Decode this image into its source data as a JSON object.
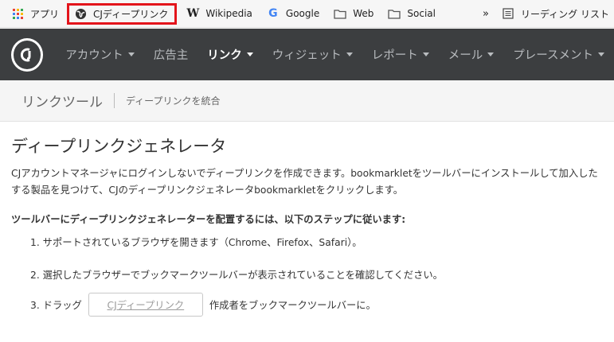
{
  "bookmarks": {
    "apps_label": "アプリ",
    "items": [
      {
        "label": "CJディープリンク",
        "icon": "globe-icon"
      },
      {
        "label": "Wikipedia",
        "icon": "wikipedia-icon"
      },
      {
        "label": "Google",
        "icon": "google-icon"
      },
      {
        "label": "Web",
        "icon": "folder-icon"
      },
      {
        "label": "Social",
        "icon": "folder-icon"
      }
    ],
    "overflow": "»",
    "reading_list": "リーディング リスト"
  },
  "nav": {
    "items": [
      {
        "label": "アカウント",
        "active": false
      },
      {
        "label": "広告主",
        "active": false
      },
      {
        "label": "リンク",
        "active": true
      },
      {
        "label": "ウィジェット",
        "active": false
      },
      {
        "label": "レポート",
        "active": false
      },
      {
        "label": "メール",
        "active": false
      },
      {
        "label": "プレースメント",
        "active": false
      }
    ]
  },
  "breadcrumb": {
    "title": "リンクツール",
    "subtitle": "ディープリンクを統合"
  },
  "main": {
    "heading": "ディープリンクジェネレータ",
    "intro_line1": "CJアカウントマネージャにログインしないでディープリンクを作成できます。bookmarkletをツールバーにインストールして加入した",
    "intro_line2": "する製品を見つけて、CJのディープリンクジェネレータbookmarkletをクリックします。",
    "steps_heading": "ツールバーにディープリンクジェネレーターを配置するには、以下のステップに従います:",
    "step1": "1. サポートされているブラウザを開きます（Chrome、Firefox、Safari）。",
    "step2": "2. 選択したブラウザーでブックマークツールバーが表示されていることを確認してください。",
    "step3_prefix": "3. ドラッグ",
    "step3_button": "CJディープリンク",
    "step3_suffix": "作成者をブックマークツールバーに。"
  },
  "colors": {
    "highlight_border": "#e3141b",
    "nav_bg": "#3c3e40"
  }
}
